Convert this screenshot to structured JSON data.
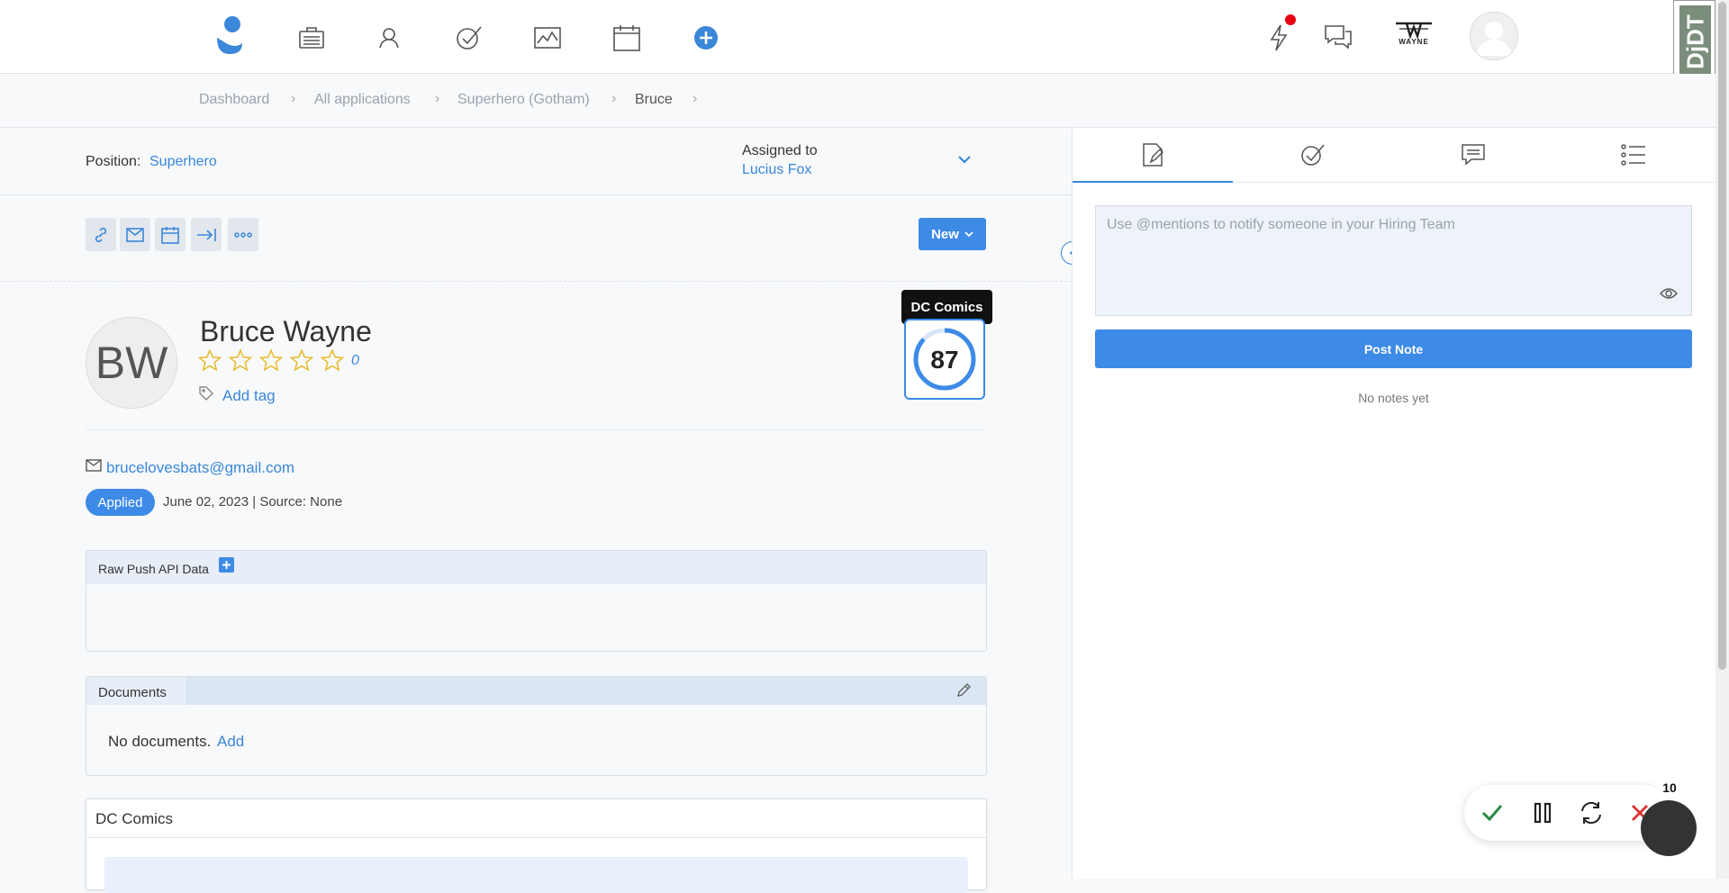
{
  "breadcrumbs": [
    {
      "label": "Dashboard"
    },
    {
      "label": "All applications"
    },
    {
      "label": "Superhero (Gotham)"
    },
    {
      "label": "Bruce"
    }
  ],
  "breadcrumb_separator": "›",
  "header": {
    "brand_logo_text": "WAYNE",
    "badge_text": "DjDT"
  },
  "position": {
    "label": "Position:",
    "value": "Superhero"
  },
  "assigned": {
    "label": "Assigned to",
    "value": "Lucius Fox"
  },
  "status_button": {
    "label": "New"
  },
  "candidate": {
    "initials": "BW",
    "name": "Bruce Wayne",
    "rating_count": "0",
    "rating_stars": 0,
    "add_tag_label": "Add tag",
    "email": "brucelovesbats@gmail.com",
    "status_badge": "Applied",
    "applied_meta": "June 02, 2023 | Source: None"
  },
  "score": {
    "tooltip": "DC Comics",
    "value": "87",
    "percent": 0.87
  },
  "panels": {
    "raw_push": {
      "title": "Raw Push API Data"
    },
    "documents": {
      "title": "Documents",
      "empty_text": "No documents.",
      "add_label": "Add"
    },
    "dc_comics": {
      "title": "DC Comics"
    }
  },
  "notes": {
    "placeholder": "Use @mentions to notify someone in your Hiring Team",
    "post_label": "Post Note",
    "empty_text": "No notes yet"
  },
  "action_bar": {
    "count": "10"
  },
  "colors": {
    "accent": "#3b87d9",
    "primary_button": "#3d8ae7",
    "star": "#e8b92a",
    "notification": "#e60012",
    "reject": "#d33",
    "approve": "#2a8a45"
  }
}
